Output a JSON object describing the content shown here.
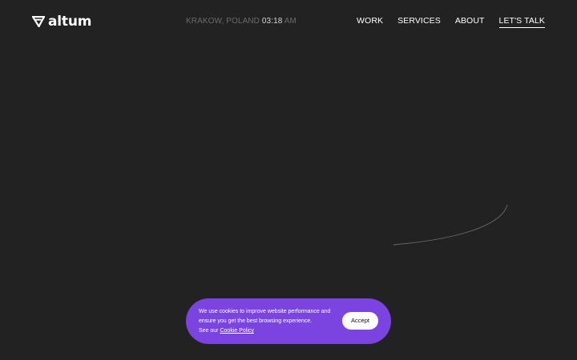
{
  "logo": {
    "text": "altum",
    "icon": "altum-triangle-logo-icon"
  },
  "header": {
    "location": "KRAKOW, POLAND",
    "time": "03:18",
    "period": "AM"
  },
  "nav": {
    "items": [
      "WORK",
      "SERVICES",
      "ABOUT"
    ],
    "cta": "LET'S TALK"
  },
  "cookie_banner": {
    "line1": "We use cookies to improve website performance and",
    "line2": "ensure you get the best browsing experience.",
    "line3_prefix": "See our",
    "policy_link": "Cookie Policy",
    "accept_label": "Accept"
  },
  "colors": {
    "background": "#222222",
    "banner": "#7b44e0",
    "muted_text": "#6a6a6a"
  }
}
